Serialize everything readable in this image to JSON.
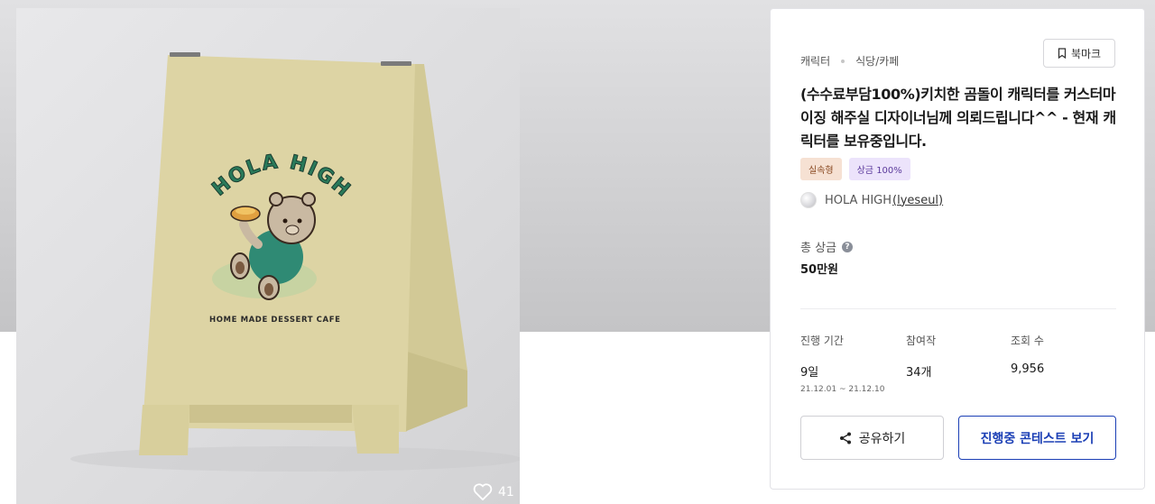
{
  "hero": {
    "sign_arc_text": "HOLA HIGH",
    "sign_subtitle": "HOME MADE DESSERT CAFE",
    "like_count": "41",
    "like_icon": "heart-icon"
  },
  "panel": {
    "categories": [
      "캐릭터",
      "식당/카페"
    ],
    "bookmark_label": "북마크",
    "bookmark_icon": "bookmark-icon",
    "title": "(수수료부담100%)키치한 곰돌이 캐릭터를 커스터마이징 해주실 디자이너님께 의뢰드립니다^^ - 현재 캐릭터를 보유중입니다.",
    "badges": [
      "실속형",
      "상금 100%"
    ],
    "host_name": "HOLA HIGH",
    "host_id": "(lyeseul)",
    "prize_label": "총 상금",
    "prize_help": "?",
    "prize_value": "50만원",
    "stats": [
      {
        "label": "진행 기간",
        "value": "9일",
        "sub": "21.12.01 ~ 21.12.10"
      },
      {
        "label": "참여작",
        "value": "34개"
      },
      {
        "label": "조회 수",
        "value": "9,956"
      }
    ],
    "share_label": "공유하기",
    "share_icon": "share-icon",
    "view_label": "진행중 콘테스트 보기"
  },
  "colors": {
    "accent": "#1b3fb5",
    "sign": "#ddd4a4",
    "logo_green": "#2a7a5a",
    "bear": "#c9b9a2"
  }
}
